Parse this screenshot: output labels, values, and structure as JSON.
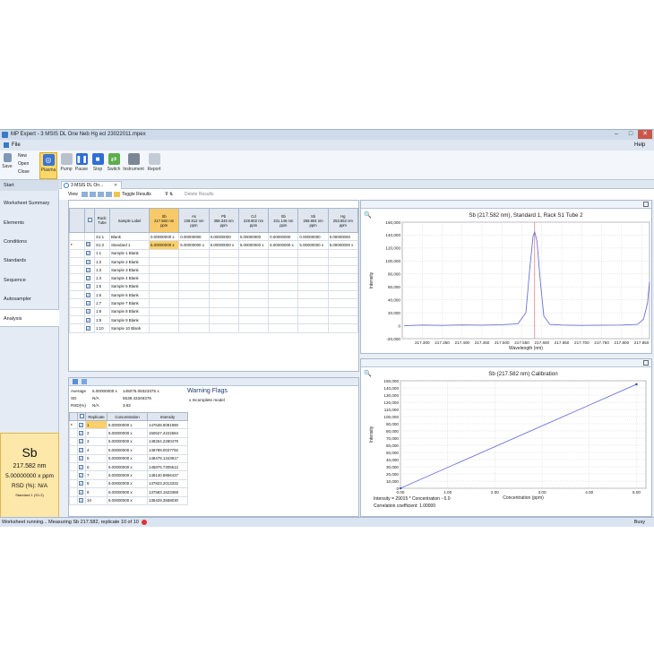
{
  "window": {
    "title": "MP Expert - 3 MSIS DL One Neb Hg ecl 23022011.mpex"
  },
  "menu": {
    "file": "File",
    "help": "Help"
  },
  "ribbon": {
    "save": "Save",
    "new": "New",
    "open": "Open",
    "close": "Close",
    "buttons": [
      "Plasma",
      "Pump",
      "Pause",
      "Stop",
      "Switch",
      "Instrument",
      "Report"
    ]
  },
  "start_label": "Start",
  "nav": [
    "Worksheet Summary",
    "Elements",
    "Conditions",
    "Standards",
    "Sequence",
    "Autosampler",
    "Analysis"
  ],
  "doc_tab": "3 MSIS DL On...",
  "viewbar": {
    "view": "View",
    "toggle": "Toggle Results",
    "delete": "Delete Results"
  },
  "grid": {
    "headers": {
      "rack": "Rack:\nTube",
      "label": "Sample Label"
    },
    "element_cols": [
      {
        "el": "Sb",
        "wl": "217.582 nm",
        "unit": "ppm"
      },
      {
        "el": "As",
        "wl": "228.812 nm",
        "unit": "ppm"
      },
      {
        "el": "Pb",
        "wl": "368.346 nm",
        "unit": "ppm"
      },
      {
        "el": "Cd",
        "wl": "228.802 nm",
        "unit": "ppm"
      },
      {
        "el": "Sb",
        "wl": "231.146 nm",
        "unit": "ppm"
      },
      {
        "el": "Sb",
        "wl": "259.804 nm",
        "unit": "ppm"
      },
      {
        "el": "Hg",
        "wl": "253.652 nm",
        "unit": "ppm"
      }
    ],
    "rows": [
      {
        "rack": "S1:1",
        "label": "Blank",
        "vals": [
          "0.00000000 x",
          "0.00000000",
          "0.00000000",
          "0.00000000",
          "0.00000000",
          "0.00000000",
          "0.00000000"
        ]
      },
      {
        "rack": "S1:2",
        "label": "Standard 1",
        "vals": [
          "5.00000000 x",
          "5.00000000 x",
          "5.00000000 x",
          "5.00000000 x",
          "5.00000000 x",
          "5.00000000 x",
          "5.00000000 x"
        ]
      },
      {
        "rack": "1:1",
        "label": "Sample 1 Blank",
        "vals": [
          "",
          "",
          "",
          "",
          "",
          "",
          ""
        ]
      },
      {
        "rack": "1:2",
        "label": "Sample 2 Blank",
        "vals": [
          "",
          "",
          "",
          "",
          "",
          "",
          ""
        ]
      },
      {
        "rack": "1:3",
        "label": "Sample 3 Blank",
        "vals": [
          "",
          "",
          "",
          "",
          "",
          "",
          ""
        ]
      },
      {
        "rack": "1:4",
        "label": "Sample 4 Blank",
        "vals": [
          "",
          "",
          "",
          "",
          "",
          "",
          ""
        ]
      },
      {
        "rack": "1:5",
        "label": "Sample 5 Blank",
        "vals": [
          "",
          "",
          "",
          "",
          "",
          "",
          ""
        ]
      },
      {
        "rack": "1:6",
        "label": "Sample 6 Blank",
        "vals": [
          "",
          "",
          "",
          "",
          "",
          "",
          ""
        ]
      },
      {
        "rack": "1:7",
        "label": "Sample 7 Blank",
        "vals": [
          "",
          "",
          "",
          "",
          "",
          "",
          ""
        ]
      },
      {
        "rack": "1:8",
        "label": "Sample 8 Blank",
        "vals": [
          "",
          "",
          "",
          "",
          "",
          "",
          ""
        ]
      },
      {
        "rack": "1:9",
        "label": "Sample 9 Blank",
        "vals": [
          "",
          "",
          "",
          "",
          "",
          "",
          ""
        ]
      },
      {
        "rack": "1:10",
        "label": "Sample 10 Blank",
        "vals": [
          "",
          "",
          "",
          "",
          "",
          "",
          ""
        ]
      }
    ]
  },
  "stats": {
    "average_label": "Average",
    "average_conc": "5.00000000 x",
    "average_int": "145075.09323375 x",
    "sd_label": "SD",
    "sd_conc": "N/A",
    "sd_int": "5538.43346376",
    "rsd_label": "RSD(%)",
    "rsd_conc": "N/A",
    "rsd_int": "3.82"
  },
  "warning": {
    "title": "Warning Flags",
    "item": "x Incomplete model"
  },
  "replicates": {
    "headers": [
      "Replicate",
      "Concentration",
      "Intensity"
    ],
    "rows": [
      [
        "1",
        "5.00000000 x",
        "147638.8081990"
      ],
      [
        "2",
        "5.00000000 x",
        "150627.4222584"
      ],
      [
        "3",
        "5.00000000 x",
        "148264.2280479"
      ],
      [
        "4",
        "5.00000000 x",
        "149789.0037792"
      ],
      [
        "5",
        "5.00000000 x",
        "148478.1343917"
      ],
      [
        "6",
        "5.00000000 x",
        "145876.7305612"
      ],
      [
        "7",
        "5.00000000 x",
        "148140.8856437"
      ],
      [
        "8",
        "5.00000000 x",
        "137823.2013332"
      ],
      [
        "9",
        "5.00000000 x",
        "137583.1623369"
      ],
      [
        "10",
        "5.00000000 x",
        "136429.3558030"
      ]
    ]
  },
  "summary": {
    "element": "Sb",
    "wavelength": "217.582 nm",
    "conc": "5.00000000 x ppm",
    "rsd": "RSD (%): N/A",
    "sub": "Standard 1 (S1:2)"
  },
  "status": {
    "text": "Worksheet running... Measuring Sb 217.582, replicate 10 of 10",
    "busy": "Busy"
  },
  "chart_data": [
    {
      "type": "line",
      "title": "Sb (217.582 nm), Standard 1, Rack S1 Tube 2",
      "xlabel": "Wavelength (nm)",
      "ylabel": "Intensity",
      "xlim": [
        217.25,
        217.87
      ],
      "ylim": [
        -20000,
        160000
      ],
      "xticks": [
        "217.300",
        "217.350",
        "217.400",
        "217.450",
        "217.500",
        "217.550",
        "217.600",
        "217.650",
        "217.700",
        "217.750",
        "217.800",
        "217.850"
      ],
      "yticks": [
        "-20,000",
        "0",
        "20,000",
        "40,000",
        "60,000",
        "80,000",
        "100,000",
        "120,000",
        "140,000",
        "160,000"
      ],
      "series": [
        {
          "x": [
            217.255,
            217.3,
            217.35,
            217.4,
            217.45,
            217.5,
            217.54,
            217.56,
            217.57,
            217.578,
            217.582,
            217.588,
            217.596,
            217.605,
            217.62,
            217.65,
            217.7,
            217.75,
            217.8,
            217.84,
            217.855,
            217.865,
            217.87
          ],
          "values": [
            0,
            1000,
            500,
            1200,
            800,
            1500,
            3000,
            20000,
            90000,
            138000,
            145000,
            130000,
            70000,
            15000,
            2000,
            1000,
            500,
            800,
            1000,
            2000,
            10000,
            35000,
            68000
          ]
        }
      ],
      "markers": [
        217.582
      ]
    },
    {
      "type": "line",
      "title": "Sb (217.582 nm) Calibration",
      "xlabel": "Concentration (ppm)",
      "ylabel": "Intensity",
      "xlim": [
        0,
        5.2
      ],
      "ylim": [
        0,
        150000
      ],
      "xticks": [
        "0.00",
        "1.00",
        "2.00",
        "3.00",
        "4.00",
        "5.00"
      ],
      "yticks": [
        "0",
        "10,000",
        "20,000",
        "30,000",
        "40,000",
        "50,000",
        "60,000",
        "70,000",
        "80,000",
        "90,000",
        "100,000",
        "110,000",
        "120,000",
        "130,000",
        "140,000",
        "150,000"
      ],
      "series": [
        {
          "x": [
            0,
            5
          ],
          "values": [
            0,
            145075
          ]
        }
      ],
      "equation": "Intensity = 29015 * Concentration - 0.0",
      "correlation": "Correlation coefficient: 1.00000"
    }
  ]
}
